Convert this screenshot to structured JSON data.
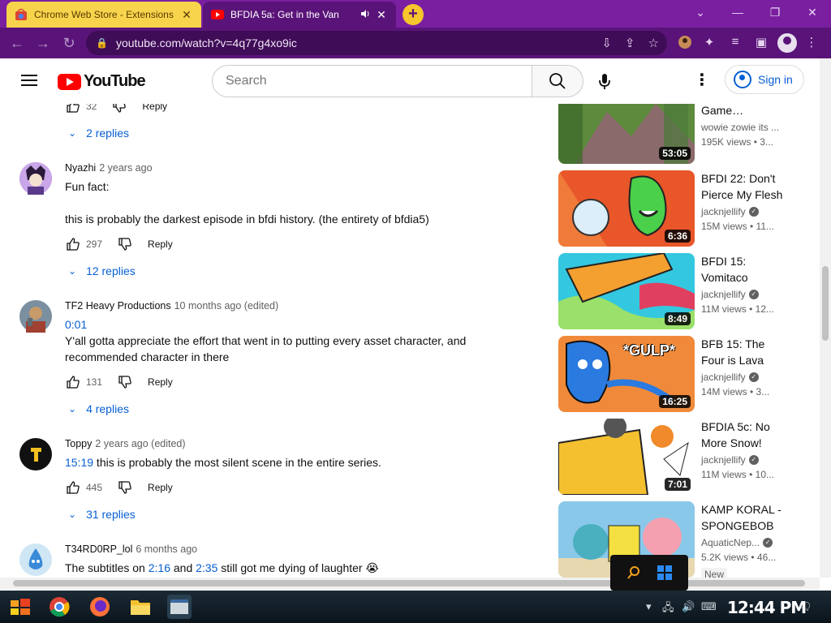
{
  "tabs": [
    {
      "title": "Chrome Web Store - Extensions",
      "close": "✕"
    },
    {
      "title": "BFDIA 5a: Get in the Van",
      "close": "✕",
      "mute": "🔇"
    }
  ],
  "new_tab": "+",
  "window_controls": {
    "minimize": "⌄",
    "min2": "—",
    "restore": "❐",
    "close": "✕"
  },
  "address": {
    "url": "youtube.com/watch?v=4q77g4xo9ic"
  },
  "youtube": {
    "logo": "YouTube",
    "search_placeholder": "Search",
    "sign_in": "Sign in"
  },
  "top_partial": {
    "likes": "32",
    "reply": "Reply",
    "replies": "2 replies"
  },
  "comments": [
    {
      "author": "Nyazhi",
      "date": "2 years ago",
      "text": "Fun fact:\n\nthis is probably the darkest episode in bfdi history. (the entirety of bfdia5)",
      "likes": "297",
      "reply": "Reply",
      "replies": "12 replies"
    },
    {
      "author": "TF2 Heavy Productions",
      "date": "10 months ago (edited)",
      "timestamp": "0:01",
      "text": "Y'all gotta appreciate the effort that went in to putting every asset character, and recommended character in there",
      "likes": "131",
      "reply": "Reply",
      "replies": "4 replies"
    },
    {
      "author": "Toppy",
      "date": "2 years ago (edited)",
      "timestamp": "15:19",
      "text": " this is probably the most silent scene in the entire series.",
      "likes": "445",
      "reply": "Reply",
      "replies": "31 replies"
    },
    {
      "author": "T34RD0RP_lol",
      "date": "6 months ago",
      "text_a": "The subtitles on ",
      "ts_a": "2:16",
      "text_b": " and ",
      "ts_b": "2:35",
      "text_c": " still got me dying of laughter 😭"
    }
  ],
  "recommendations": [
    {
      "title": "Game…",
      "channel": "wowie zowie its ...",
      "meta": "195K views • 3...",
      "duration": "53:05",
      "thumb_color": "#7a8a5a",
      "verified": false
    },
    {
      "title": "BFDI 22: Don't Pierce My Flesh",
      "channel": "jacknjellify",
      "meta": "15M views • 11...",
      "duration": "6:36",
      "thumb_color": "#e8562a",
      "verified": true
    },
    {
      "title": "BFDI 15: Vomitaco",
      "channel": "jacknjellify",
      "meta": "11M views • 12...",
      "duration": "8:49",
      "thumb_color": "#33c8e0",
      "verified": true
    },
    {
      "title": "BFB 15: The Four is Lava",
      "channel": "jacknjellify",
      "meta": "14M views • 3...",
      "duration": "16:25",
      "thumb_color": "#f08a3a",
      "verified": true,
      "overlay": "*GULP*"
    },
    {
      "title": "BFDIA 5c: No More Snow!",
      "channel": "jacknjellify",
      "meta": "11M views • 10...",
      "duration": "7:01",
      "thumb_color": "#f4c030",
      "verified": true
    },
    {
      "title": "KAMP KORAL - SPONGEBOB",
      "channel": "AquaticNep...",
      "meta": "5.2K views • 46...",
      "badge": "New",
      "thumb_color": "#4ab0d8",
      "verified": true
    }
  ],
  "taskbar": {
    "clock": "12:44 PM"
  },
  "colors": {
    "tab_bar": "#7a1fa0",
    "toolbar": "#5a1479",
    "youtube_red": "#ff0000",
    "link_blue": "#065fd4"
  }
}
